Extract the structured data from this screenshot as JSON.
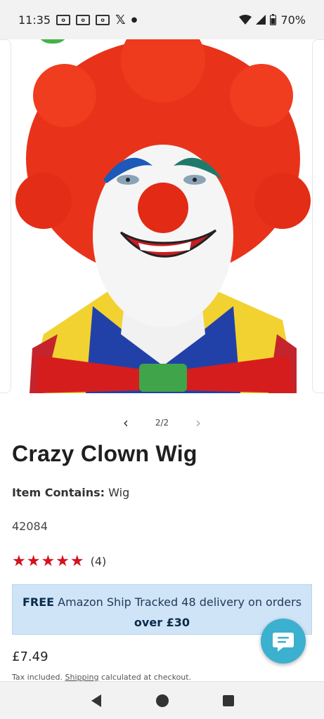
{
  "status_bar": {
    "time": "11:35",
    "notif_icons": [
      "outlook-icon",
      "outlook-icon",
      "outlook-icon",
      "x-icon"
    ],
    "battery": "70%"
  },
  "gallery": {
    "pager": "2/2"
  },
  "product": {
    "title": "Crazy Clown Wig",
    "contains_label": "Item Contains:",
    "contains_value": "Wig",
    "sku": "42084",
    "stars": "★★★★★",
    "rating_count": "(4)",
    "price": "£7.49"
  },
  "shipping_banner": {
    "free": "FREE",
    "text": "Amazon Ship Tracked 48 delivery on orders",
    "threshold": "over £30"
  },
  "tax_note": {
    "before": "Tax included.",
    "link": "Shipping",
    "after": "calculated at checkout."
  },
  "colors": {
    "star": "#d3121d",
    "banner_bg": "#cfe4f7",
    "chat": "#3bb0cf"
  }
}
